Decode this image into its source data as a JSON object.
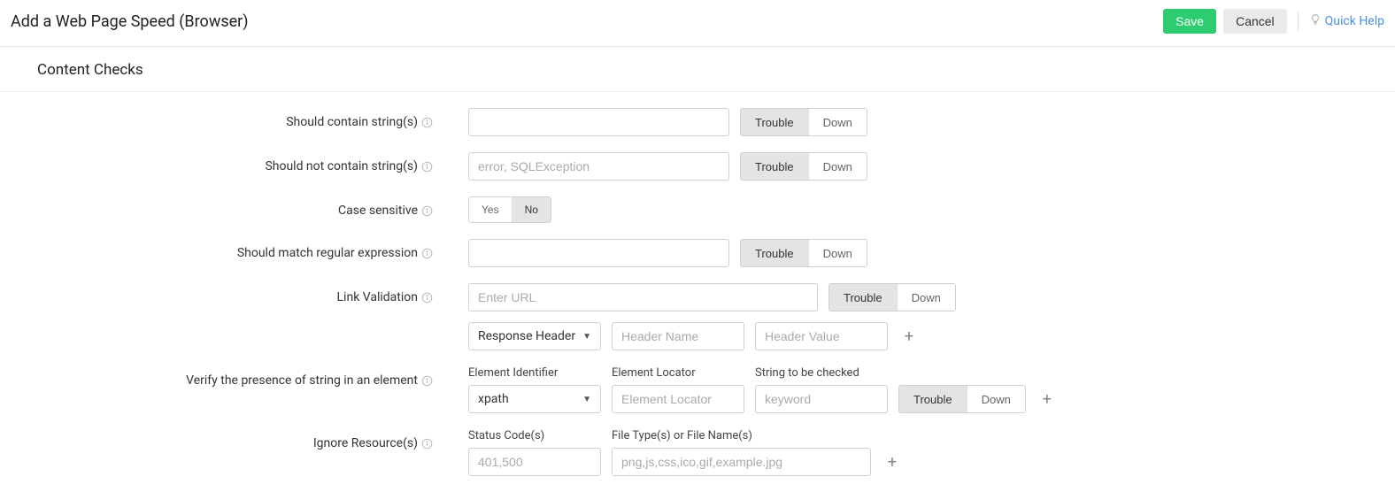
{
  "header": {
    "title": "Add a Web Page Speed (Browser)",
    "save": "Save",
    "cancel": "Cancel",
    "quick_help": "Quick Help"
  },
  "section": {
    "title": "Content Checks"
  },
  "labels": {
    "contain": "Should contain string(s)",
    "not_contain": "Should not contain string(s)",
    "case_sensitive": "Case sensitive",
    "regex": "Should match regular expression",
    "link_validation": "Link Validation",
    "verify_string": "Verify the presence of string in an element",
    "ignore_resources": "Ignore Resource(s)"
  },
  "toggles": {
    "trouble": "Trouble",
    "down": "Down",
    "yes": "Yes",
    "no": "No"
  },
  "placeholders": {
    "not_contain": "error, SQLException",
    "link_url": "Enter URL",
    "header_name": "Header Name",
    "header_value": "Header Value",
    "element_locator": "Element Locator",
    "keyword": "keyword",
    "status_codes": "401,500",
    "file_types": "png,js,css,ico,gif,example.jpg"
  },
  "selects": {
    "response_header": "Response Header",
    "xpath": "xpath"
  },
  "sublabels": {
    "element_identifier": "Element Identifier",
    "element_locator": "Element Locator",
    "string_checked": "String to be checked",
    "status_codes": "Status Code(s)",
    "file_types": "File Type(s) or File Name(s)"
  }
}
